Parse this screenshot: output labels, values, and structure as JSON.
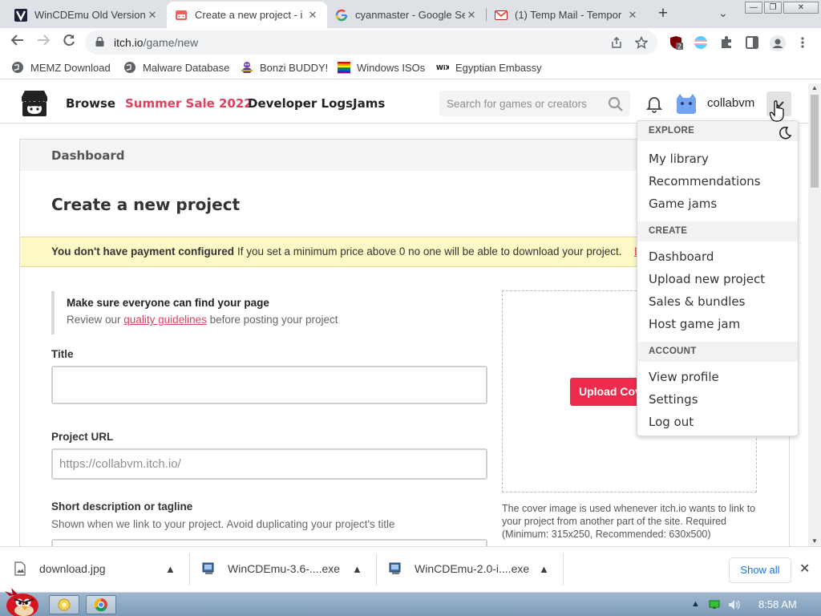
{
  "browser": {
    "tabs": [
      {
        "title": "WinCDEmu Old Version",
        "icon": "v-logo-icon",
        "active": false
      },
      {
        "title": "Create a new project - i",
        "icon": "itch-icon",
        "active": true
      },
      {
        "title": "cyanmaster - Google Se",
        "icon": "google-icon",
        "active": false
      },
      {
        "title": "(1) Temp Mail - Tempor",
        "icon": "gmail-icon",
        "active": false
      }
    ],
    "new_tab_label": "+",
    "tab_search_label": "⌄",
    "window_controls": {
      "minimize": "—",
      "restore": "❐",
      "close": "✕"
    },
    "url_host": "itch.io",
    "url_path": "/game/new",
    "extension_badge": "2"
  },
  "bookmarks": [
    {
      "label": "MEMZ Download",
      "icon": "globe-icon"
    },
    {
      "label": "Malware Database",
      "icon": "globe-icon"
    },
    {
      "label": "Bonzi BUDDY!",
      "icon": "bonzi-icon"
    },
    {
      "label": "Windows ISOs",
      "icon": "windows-flag-icon"
    },
    {
      "label": "Egyptian Embassy",
      "icon": "wix-icon"
    }
  ],
  "site": {
    "nav": [
      {
        "label": "Browse"
      },
      {
        "label": "Summer Sale 2022"
      },
      {
        "label": "Developer Logs"
      },
      {
        "label": "Jams"
      }
    ],
    "search_placeholder": "Search for games or creators",
    "username": "collabvm",
    "accent_color": "#e0415e"
  },
  "page": {
    "breadcrumb": "Dashboard",
    "title": "Create a new project",
    "warning_strong": "You don't have payment configured",
    "warning_msg": "If you set a minimum price above 0 no one will be able to download your project.",
    "warning_link": "E",
    "notice_heading": "Make sure everyone can find your page",
    "notice_pre": "Review our",
    "notice_link": "quality guidelines",
    "notice_post": "before posting your project",
    "title_label": "Title",
    "title_value": "",
    "url_label": "Project URL",
    "url_placeholder": "https://collabvm.itch.io/",
    "tagline_label": "Short description or tagline",
    "tagline_sub": "Shown when we link to your project. Avoid duplicating your project's title",
    "cover_button": "Upload Cover Image",
    "cover_note": "The cover image is used whenever itch.io wants to link to your project from another part of the site. Required (Minimum: 315x250, Recommended: 630x500)"
  },
  "dropdown": {
    "sections": [
      {
        "heading": "EXPLORE",
        "items": [
          "My library",
          "Recommendations",
          "Game jams"
        ]
      },
      {
        "heading": "CREATE",
        "items": [
          "Dashboard",
          "Upload new project",
          "Sales & bundles",
          "Host game jam"
        ]
      },
      {
        "heading": "ACCOUNT",
        "items": [
          "View profile",
          "Settings",
          "Log out"
        ]
      }
    ]
  },
  "downloads": {
    "items": [
      {
        "name": "download.jpg",
        "icon": "image-file-icon"
      },
      {
        "name": "WinCDEmu-3.6-....exe",
        "icon": "exe-file-icon"
      },
      {
        "name": "WinCDEmu-2.0-i....exe",
        "icon": "exe-file-icon"
      }
    ],
    "show_all": "Show all"
  },
  "taskbar": {
    "clock": "8:58 AM"
  }
}
